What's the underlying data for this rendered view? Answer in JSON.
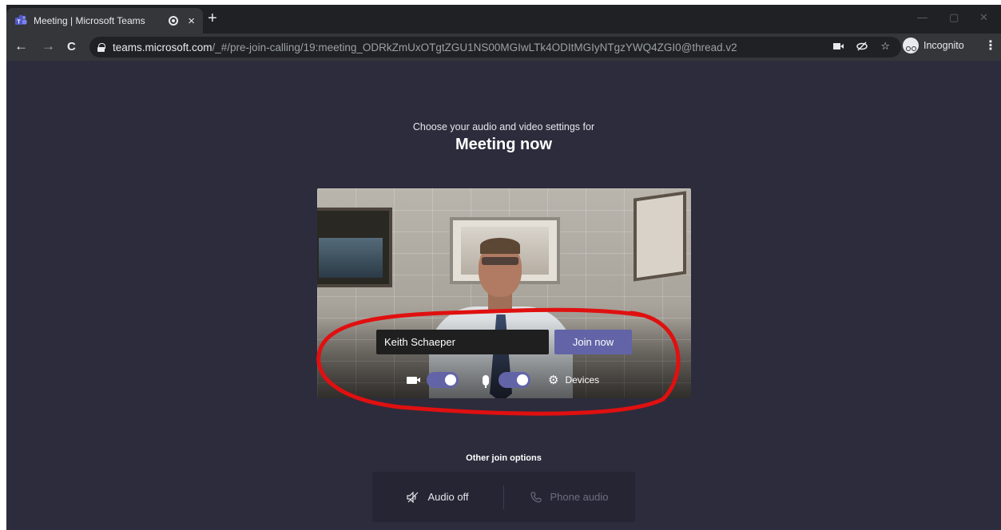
{
  "browser": {
    "tab": {
      "title": "Meeting | Microsoft Teams",
      "close_icon": "×",
      "audio_icon": "recording-dot-icon"
    },
    "new_tab_icon": "+",
    "window_controls": {
      "minimize": "—",
      "restore": "▢",
      "close": "✕"
    },
    "toolbar": {
      "back_icon": "←",
      "forward_icon": "→",
      "reload_icon": "C",
      "url_host": "teams.microsoft.com",
      "url_path": "/_#/pre-join-calling/19:meeting_ODRkZmUxOTgtZGU1NS00MGIwLTk4ODItMGIyNTgzYWQ4ZGI0@thread.v2",
      "camera_icon": "camera-in-use-icon",
      "tracking_icon": "eye-slash-icon",
      "star_icon": "☆",
      "incognito_label": "Incognito",
      "menu_icon": "⋮"
    }
  },
  "prejoin": {
    "subtitle": "Choose your audio and video settings for",
    "meeting_title": "Meeting now",
    "name_value": "Keith Schaeper",
    "join_label": "Join now",
    "camera_on": true,
    "mic_on": true,
    "devices_label": "Devices",
    "gear_icon": "⚙"
  },
  "other_options": {
    "label": "Other join options",
    "audio_off_label": "Audio off",
    "phone_audio_label": "Phone audio",
    "audio_off_icon": "speaker-off-icon",
    "phone_icon": "phone-icon"
  },
  "colors": {
    "teams_purple": "#6264a7",
    "content_bg": "#2d2c3c",
    "annotation_red": "#e01010"
  }
}
